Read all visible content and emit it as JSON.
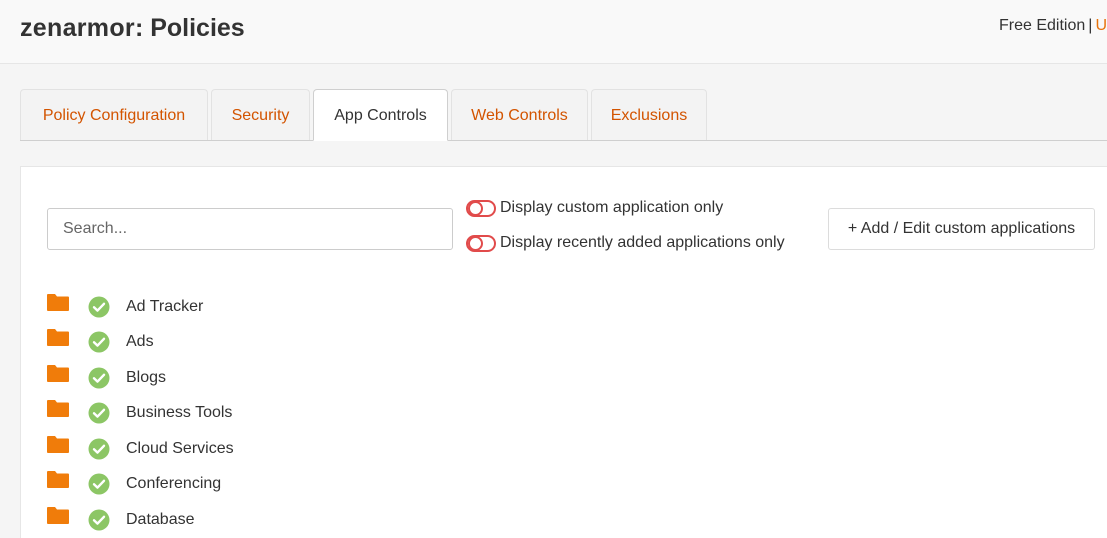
{
  "header": {
    "brand": "zenarmor",
    "title": ": Policies",
    "edition": "Free Edition",
    "separator": "|",
    "overflow_text": "U"
  },
  "tabs": [
    {
      "label": "Policy Configuration",
      "active": false
    },
    {
      "label": "Security",
      "active": false
    },
    {
      "label": "App Controls",
      "active": true
    },
    {
      "label": "Web Controls",
      "active": false
    },
    {
      "label": "Exclusions",
      "active": false
    }
  ],
  "search": {
    "placeholder": "Search...",
    "value": ""
  },
  "filters": {
    "custom_only": {
      "label": "Display custom application only",
      "enabled": false
    },
    "recent_only": {
      "label": "Display recently added applications only",
      "enabled": false
    }
  },
  "add_button": {
    "label": "+ Add / Edit custom applications"
  },
  "categories": [
    {
      "label": "Ad Tracker",
      "allowed": true
    },
    {
      "label": "Ads",
      "allowed": true
    },
    {
      "label": "Blogs",
      "allowed": true
    },
    {
      "label": "Business Tools",
      "allowed": true
    },
    {
      "label": "Cloud Services",
      "allowed": true
    },
    {
      "label": "Conferencing",
      "allowed": true
    },
    {
      "label": "Database",
      "allowed": true
    }
  ],
  "colors": {
    "accent": "#d35400",
    "folder": "#f07c0a",
    "check": "#8cc665",
    "toggle_off": "#e14b4b"
  },
  "icons": {
    "folder": "folder-icon",
    "check": "check-circle-icon"
  }
}
